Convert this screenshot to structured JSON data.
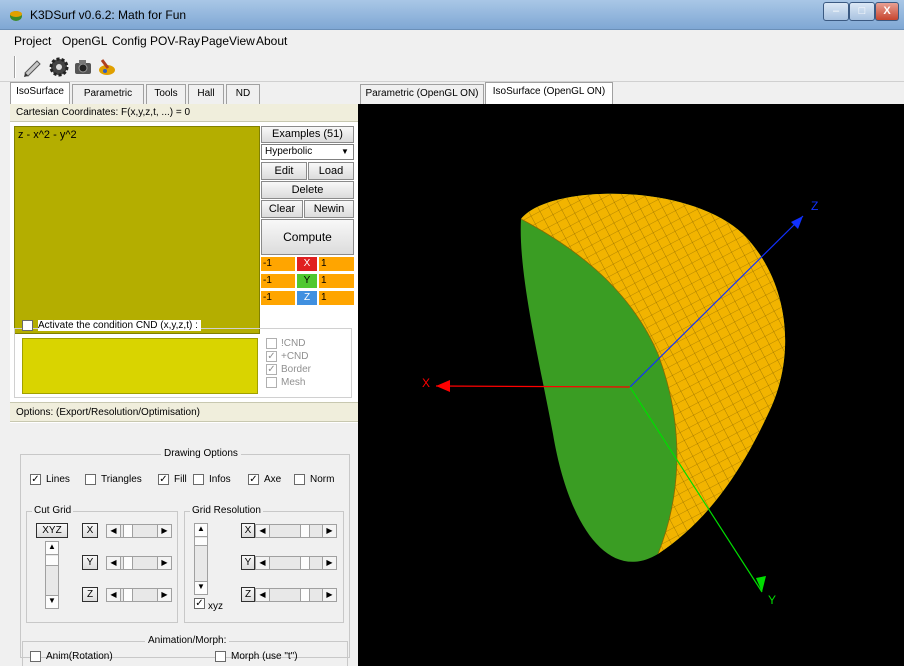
{
  "window": {
    "title": "K3DSurf v0.6.2: Math for Fun",
    "min": "–",
    "max": "□",
    "close": "X"
  },
  "menu": [
    "Project",
    "OpenGL",
    "Config",
    "POV-Ray",
    "PageView",
    "About"
  ],
  "left_tabs": [
    "IsoSurface",
    "Parametric",
    "Tools",
    "Hall",
    "ND"
  ],
  "iso": {
    "header": "Cartesian Coordinates: F(x,y,z,t, ...) = 0",
    "formula": "z - x^2 - y^2",
    "examples_btn": "Examples (51)",
    "examples_select": "Hyperbolic",
    "edit": "Edit",
    "load": "Load",
    "delete": "Delete",
    "clear": "Clear",
    "newin": "Newin",
    "compute": "Compute",
    "range": [
      {
        "min": "-1",
        "axis": "X",
        "max": "1"
      },
      {
        "min": "-1",
        "axis": "Y",
        "max": "1"
      },
      {
        "min": "-1",
        "axis": "Z",
        "max": "1"
      }
    ],
    "cnd_label": "Activate the condition CND (x,y,z,t) :",
    "cnd_opts": [
      {
        "label": "!CND",
        "checked": false
      },
      {
        "label": "+CND",
        "checked": true
      },
      {
        "label": "Border",
        "checked": true
      },
      {
        "label": "Mesh",
        "checked": false
      }
    ],
    "options_header": "Options: (Export/Resolution/Optimisation)"
  },
  "drawing": {
    "title": "Drawing Options",
    "opts": [
      {
        "label": "Lines",
        "checked": true
      },
      {
        "label": "Triangles",
        "checked": false
      },
      {
        "label": "Fill",
        "checked": true
      },
      {
        "label": "Infos",
        "checked": false
      },
      {
        "label": "Axe",
        "checked": true
      },
      {
        "label": "Norm",
        "checked": false
      }
    ],
    "cut_grid": "Cut Grid",
    "grid_resolution": "Grid Resolution",
    "xyz_btn": "XYZ",
    "axes": [
      "X",
      "Y",
      "Z"
    ],
    "xyz_check": "xyz",
    "check_mark": "✓",
    "arrow_left": "◀",
    "arrow_right": "▶",
    "arrow_up": "▲",
    "arrow_down": "▼"
  },
  "animation": {
    "title": "Animation/Morph:",
    "anim": "Anim(Rotation)",
    "morph": "Morph (use \"t\")"
  },
  "view_tabs": [
    "Parametric (OpenGL ON)",
    "IsoSurface (OpenGL ON)"
  ],
  "axes_labels": {
    "x": "X",
    "y": "Y",
    "z": "Z"
  },
  "colors": {
    "formula_bg": "#b4ae00",
    "cnd_bg": "#d9d400",
    "surface_outer": "#f2b400",
    "surface_inner": "#3a9d23",
    "axis_x": "#ff0000",
    "axis_y": "#00dd00",
    "axis_z": "#1030ff"
  }
}
